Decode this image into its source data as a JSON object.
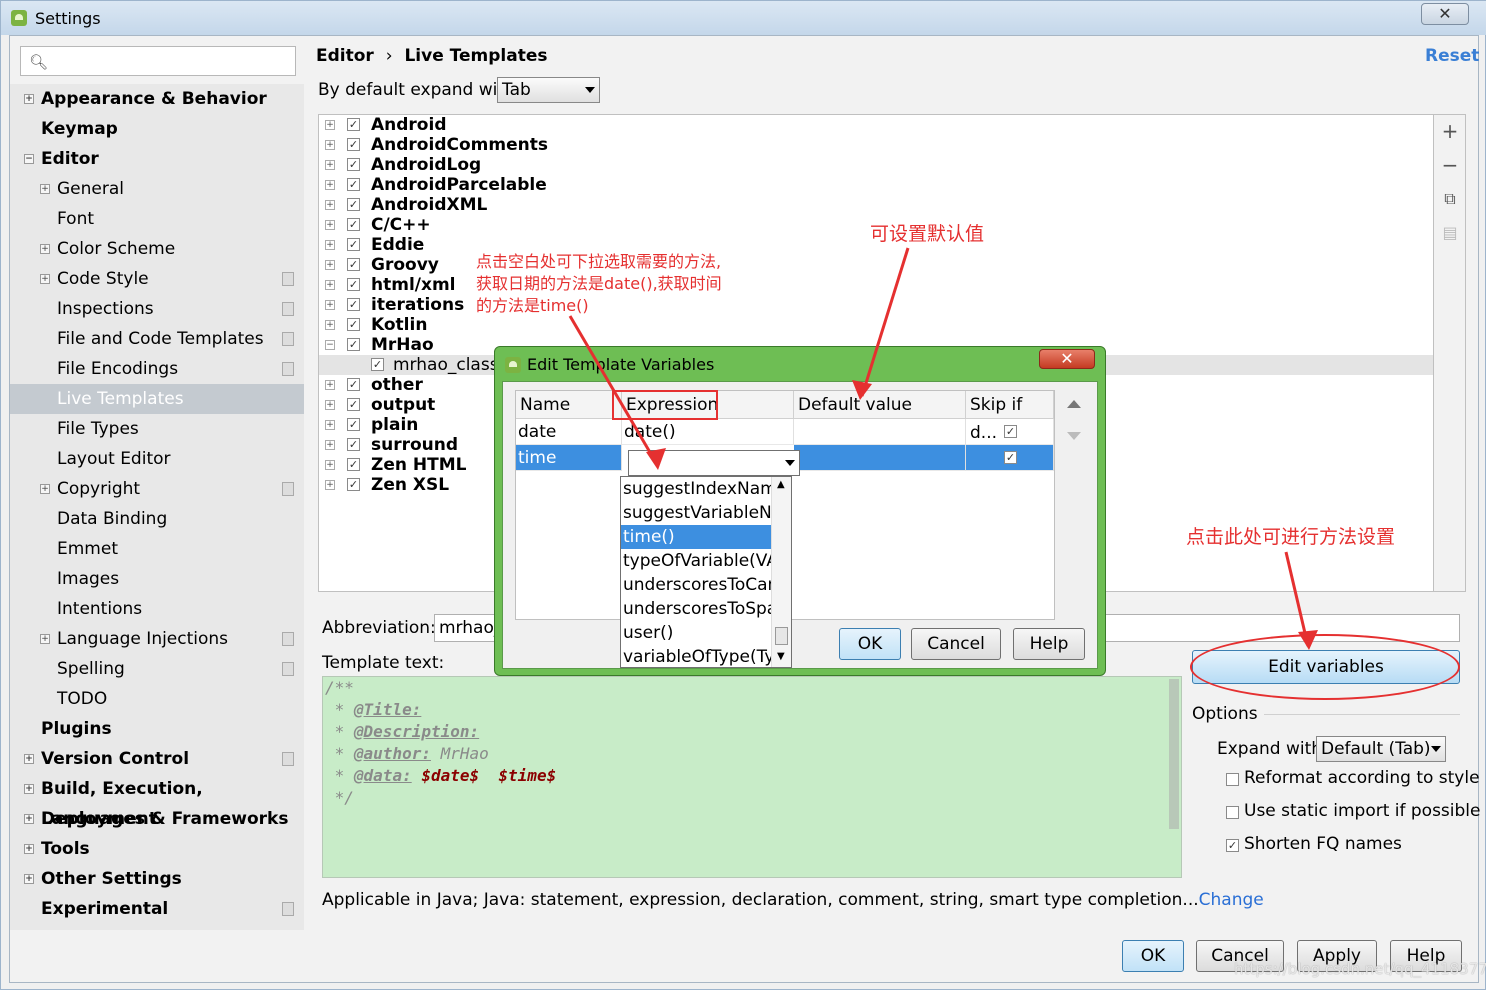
{
  "window": {
    "title": "Settings",
    "close_symbol": "✕"
  },
  "search": {
    "placeholder": "",
    "icon": "search-icon"
  },
  "nav": {
    "items": [
      {
        "label": "Appearance & Behavior",
        "bold": true,
        "expander": "+"
      },
      {
        "label": "Keymap",
        "bold": true
      },
      {
        "label": "Editor",
        "bold": true,
        "expander": "−"
      },
      {
        "label": "General",
        "expander": "+"
      },
      {
        "label": "Font"
      },
      {
        "label": "Color Scheme",
        "expander": "+"
      },
      {
        "label": "Code Style",
        "expander": "+",
        "badge": true
      },
      {
        "label": "Inspections",
        "badge": true
      },
      {
        "label": "File and Code Templates",
        "badge": true
      },
      {
        "label": "File Encodings",
        "badge": true
      },
      {
        "label": "Live Templates",
        "selected": true
      },
      {
        "label": "File Types"
      },
      {
        "label": "Layout Editor"
      },
      {
        "label": "Copyright",
        "expander": "+",
        "badge": true
      },
      {
        "label": "Data Binding"
      },
      {
        "label": "Emmet"
      },
      {
        "label": "Images"
      },
      {
        "label": "Intentions"
      },
      {
        "label": "Language Injections",
        "expander": "+",
        "badge": true
      },
      {
        "label": "Spelling",
        "badge": true
      },
      {
        "label": "TODO"
      },
      {
        "label": "Plugins",
        "bold": true
      },
      {
        "label": "Version Control",
        "bold": true,
        "expander": "+",
        "badge": true
      },
      {
        "label": "Build, Execution, Deployment",
        "bold": true,
        "expander": "+"
      },
      {
        "label": "Languages & Frameworks",
        "bold": true,
        "expander": "+"
      },
      {
        "label": "Tools",
        "bold": true,
        "expander": "+"
      },
      {
        "label": "Other Settings",
        "bold": true,
        "expander": "+"
      },
      {
        "label": "Experimental",
        "bold": true,
        "badge": true
      }
    ]
  },
  "header": {
    "crumb_parent": "Editor",
    "crumb_sep": "›",
    "crumb_current": "Live Templates",
    "reset": "Reset"
  },
  "expand_default": {
    "label": "By default expand with",
    "value": "Tab"
  },
  "tree": {
    "groups": [
      {
        "label": "Android",
        "checked": true,
        "expander": "+"
      },
      {
        "label": "AndroidComments",
        "checked": true,
        "expander": "+"
      },
      {
        "label": "AndroidLog",
        "checked": true,
        "expander": "+"
      },
      {
        "label": "AndroidParcelable",
        "checked": true,
        "expander": "+"
      },
      {
        "label": "AndroidXML",
        "checked": true,
        "expander": "+"
      },
      {
        "label": "C/C++",
        "checked": true,
        "expander": "+"
      },
      {
        "label": "Eddie",
        "checked": true,
        "expander": "+"
      },
      {
        "label": "Groovy",
        "checked": true,
        "expander": "+"
      },
      {
        "label": "html/xml",
        "checked": true,
        "expander": "+"
      },
      {
        "label": "iterations",
        "checked": true,
        "expander": "+"
      },
      {
        "label": "Kotlin",
        "checked": true,
        "expander": "+"
      },
      {
        "label": "MrHao",
        "checked": true,
        "expander": "−"
      },
      {
        "label": "mrhao_classn",
        "checked": true,
        "child": true,
        "selected": true
      },
      {
        "label": "other",
        "checked": true,
        "expander": "+"
      },
      {
        "label": "output",
        "checked": true,
        "expander": "+"
      },
      {
        "label": "plain",
        "checked": true,
        "expander": "+"
      },
      {
        "label": "surround",
        "checked": true,
        "expander": "+"
      },
      {
        "label": "Zen HTML",
        "checked": true,
        "expander": "+"
      },
      {
        "label": "Zen XSL",
        "checked": true,
        "expander": "+"
      }
    ],
    "toolbar": [
      "add-icon",
      "remove-icon",
      "copy-icon",
      "restore-icon"
    ]
  },
  "abbreviation": {
    "label": "Abbreviation:",
    "value": "mrhao_"
  },
  "template_text": {
    "label": "Template text:",
    "lines": [
      "/**",
      " * ",
      "@Title:",
      " * ",
      "@Description:",
      " * ",
      "@author:",
      " MrHao",
      " * ",
      "@data:",
      "$date$",
      "$time$",
      " */"
    ]
  },
  "applicable": {
    "text": "Applicable in Java; Java: statement, expression, declaration, comment, string, smart type completion...",
    "link": "Change"
  },
  "edit_variables": {
    "label": "Edit variables"
  },
  "options": {
    "title": "Options",
    "expand_with_label": "Expand with",
    "expand_with_value": "Default (Tab)",
    "reformat": {
      "label": "Reformat according to style",
      "checked": false
    },
    "static_import": {
      "label": "Use static import if possible",
      "checked": false
    },
    "shorten_fq": {
      "label": "Shorten FQ names",
      "checked": true
    }
  },
  "footer": {
    "ok": "OK",
    "cancel": "Cancel",
    "apply": "Apply",
    "help": "Help"
  },
  "dialog": {
    "title": "Edit Template Variables",
    "close_symbol": "✕",
    "columns": [
      "Name",
      "Expression",
      "Default value",
      "Skip if d..."
    ],
    "rows": [
      {
        "name": "date",
        "expression": "date()",
        "default": "",
        "skip": true
      },
      {
        "name": "time",
        "expression": "",
        "default": "",
        "skip": true,
        "selected": true
      }
    ],
    "dropdown": [
      "suggestIndexName",
      "suggestVariableNar",
      "time()",
      "typeOfVariable(VAR",
      "underscoresToCam",
      "underscoresToSpac",
      "user()",
      "variableOfType(Typ"
    ],
    "dropdown_selected": "time()",
    "ok": "OK",
    "cancel": "Cancel",
    "help": "Help"
  },
  "annotations": {
    "dropdown_hint": [
      "点击空白处可下拉选取需要的方法,",
      "获取日期的方法是date(),获取时间",
      "的方法是time()"
    ],
    "default_value_hint": "可设置默认值",
    "edit_vars_hint": "点击此处可进行方法设置",
    "color": "#e53030"
  },
  "watermark": "https://blog.csdn.net/qq_41183772"
}
